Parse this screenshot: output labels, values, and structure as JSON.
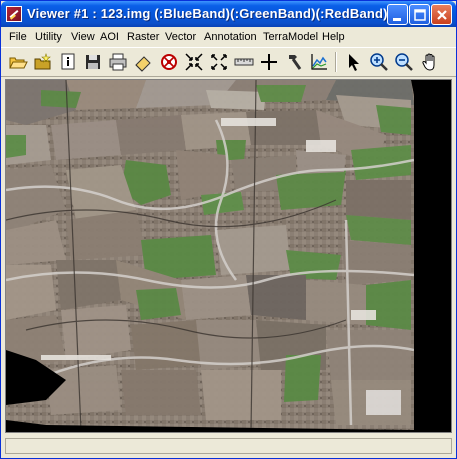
{
  "window": {
    "title": "Viewer #1 : 123.img (:BlueBand)(:GreenBand)(:RedBand)"
  },
  "title_buttons": [
    "minimize",
    "maximize",
    "close"
  ],
  "menu": [
    {
      "label": "File"
    },
    {
      "label": "Utility"
    },
    {
      "label": "View"
    },
    {
      "label": "AOI"
    },
    {
      "label": "Raster"
    },
    {
      "label": "Vector"
    },
    {
      "label": "Annotation"
    },
    {
      "label": "TerraModel"
    },
    {
      "label": "Help"
    }
  ],
  "toolbar": {
    "tools": [
      "open-folder-icon",
      "new-folder-icon",
      "info-icon",
      "save-icon",
      "print-icon",
      "eraser-icon",
      "target-icon",
      "zoom-in-arrows-icon",
      "fit-arrows-icon",
      "measure-icon",
      "crosshair-icon",
      "hammer-icon",
      "profile-icon",
      "select-arrow-icon",
      "zoom-in-icon",
      "zoom-out-icon",
      "pan-hand-icon"
    ]
  },
  "image": {
    "description_kind": "multispectral satellite image of agricultural fields",
    "colors": {
      "background": "#000000",
      "field_green": "#5f8d49",
      "soil": "#8a7d72",
      "road": "#d6d3d0"
    }
  },
  "status": {
    "text": ""
  },
  "colors": {
    "titlebar": "#0655d8",
    "window": "#ece9d8"
  }
}
